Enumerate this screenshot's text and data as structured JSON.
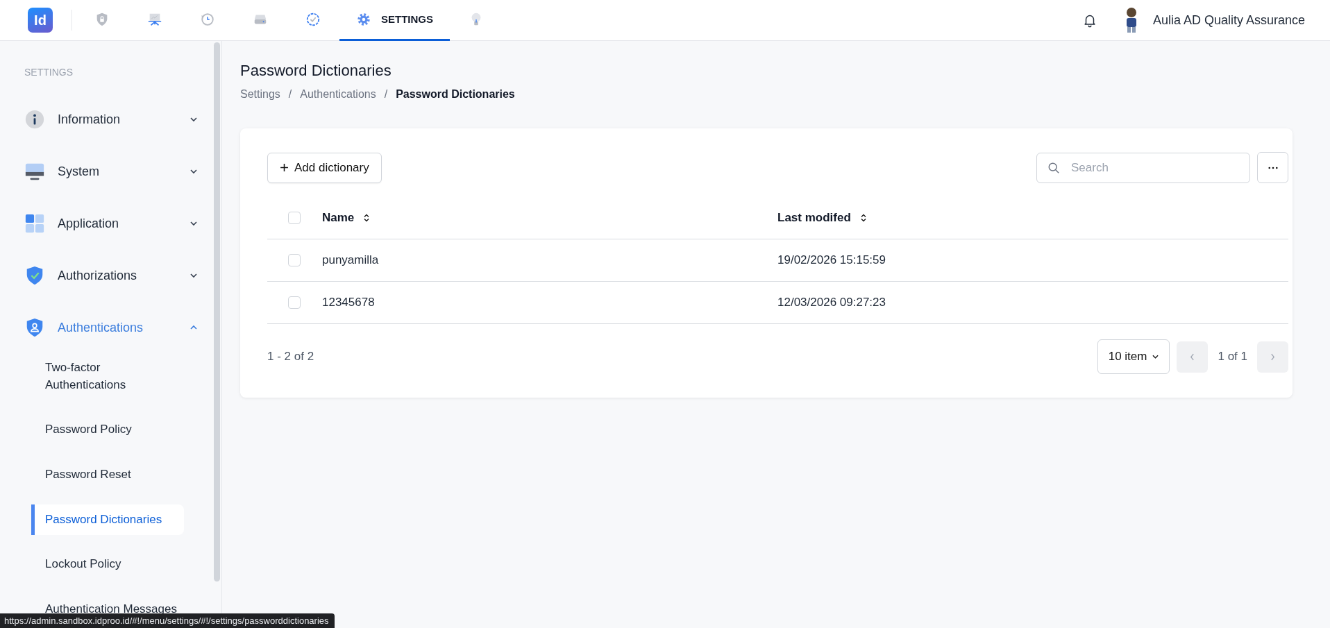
{
  "nav": {
    "logo": "Id",
    "tabs": [
      {
        "selected": false
      },
      {
        "selected": false
      },
      {
        "selected": false
      },
      {
        "selected": false
      },
      {
        "selected": false
      },
      {
        "label": "SETTINGS",
        "selected": true
      },
      {
        "selected": false
      }
    ],
    "user": {
      "name": "Aulia AD Quality Assurance"
    }
  },
  "sidebar": {
    "heading": "SETTINGS",
    "items": [
      {
        "label": "Information",
        "expanded": false
      },
      {
        "label": "System",
        "expanded": false
      },
      {
        "label": "Application",
        "expanded": false
      },
      {
        "label": "Authorizations",
        "expanded": false
      },
      {
        "label": "Authentications",
        "expanded": true,
        "children": [
          {
            "label": "Two-factor Authentications",
            "selected": false
          },
          {
            "label": "Password Policy",
            "selected": false
          },
          {
            "label": "Password Reset",
            "selected": false
          },
          {
            "label": "Password Dictionaries",
            "selected": true
          },
          {
            "label": "Lockout Policy",
            "selected": false
          },
          {
            "label": "Authentication Messages",
            "selected": false
          }
        ]
      }
    ]
  },
  "page": {
    "title": "Password Dictionaries",
    "breadcrumb": [
      "Settings",
      "Authentications",
      "Password Dictionaries"
    ],
    "separator": "/"
  },
  "toolbar": {
    "add_button": "Add dictionary",
    "search": {
      "placeholder": "Search"
    }
  },
  "table": {
    "header_checked": false,
    "columns": [
      "Name",
      "Last modifed"
    ],
    "rows": [
      {
        "checked": false,
        "cells": [
          "punyamilla",
          "19/02/2026 15:15:59"
        ]
      },
      {
        "checked": false,
        "cells": [
          "12345678",
          "12/03/2026 09:27:23"
        ]
      }
    ]
  },
  "pagination": {
    "range": "1 - 2 of 2",
    "page_size": "10 item",
    "page": "1 of 1",
    "prev_disabled": true,
    "next_disabled": true
  },
  "status_bar": {
    "url": "https://admin.sandbox.idproo.id/#!/menu/settings/#!/settings/passworddictionaries"
  }
}
